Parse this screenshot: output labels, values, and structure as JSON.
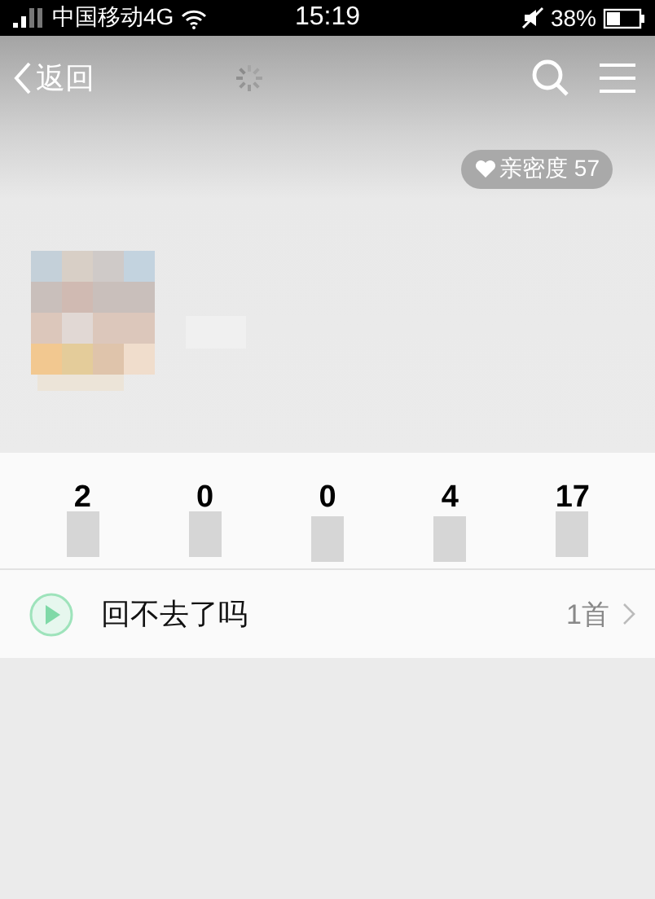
{
  "status_bar": {
    "carrier": "中国移动4G",
    "time": "15:19",
    "battery": "38%"
  },
  "nav": {
    "back": "返回"
  },
  "intimacy_badge": {
    "label": "亲密度 57"
  },
  "stats": [
    {
      "value": "2"
    },
    {
      "value": "0"
    },
    {
      "value": "0"
    },
    {
      "value": "4"
    },
    {
      "value": "17"
    }
  ],
  "song_row": {
    "title": "回不去了吗",
    "count": "1首"
  }
}
